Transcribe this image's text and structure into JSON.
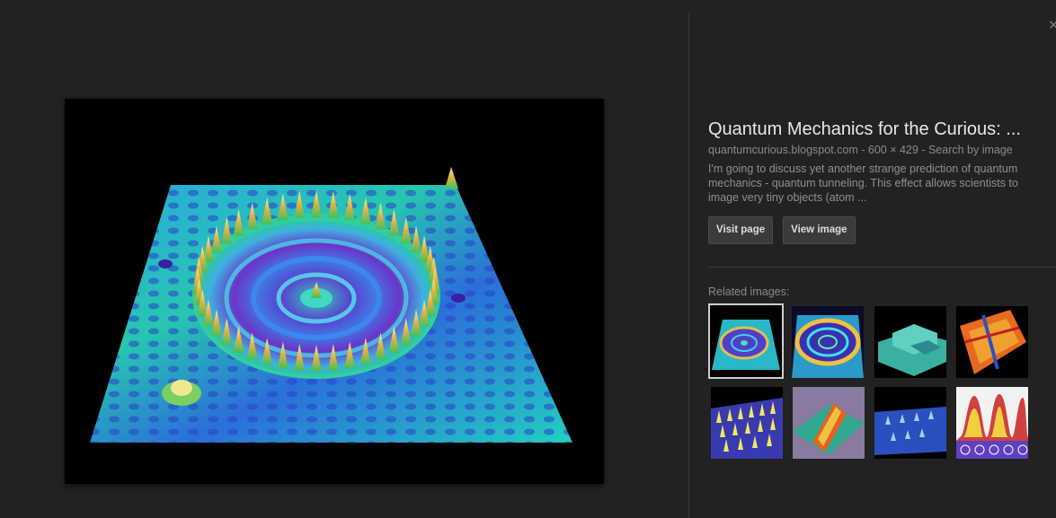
{
  "result": {
    "title": "Quantum Mechanics for the Curious: ...",
    "source": "quantumcurious.blogspot.com",
    "dimensions": "600 × 429",
    "search_by_image": "Search by image",
    "meta_separator": " - ",
    "description": "I'm going to discuss yet another strange prediction of quantum mechanics - quantum tunneling. This effect allows scientists to image very tiny objects (atom ..."
  },
  "buttons": {
    "visit_page": "Visit page",
    "view_image": "View image"
  },
  "related": {
    "label": "Related images:",
    "thumbnails": [
      {
        "name": "quantum-corral-thumb",
        "selected": true
      },
      {
        "name": "quantum-corral-rainbow-thumb",
        "selected": false
      },
      {
        "name": "surface-steps-thumb",
        "selected": false
      },
      {
        "name": "orange-atom-lattice-thumb",
        "selected": false
      },
      {
        "name": "yellow-spikes-thumb",
        "selected": false
      },
      {
        "name": "orange-ridge-thumb",
        "selected": false
      },
      {
        "name": "blue-peaks-thumb",
        "selected": false
      },
      {
        "name": "orbital-peaks-thumb",
        "selected": false
      }
    ]
  },
  "icons": {
    "close": "close-icon"
  },
  "colors": {
    "background": "#222222",
    "button": "#3b3b3b",
    "title": "#e8e8e8",
    "muted": "#8a8a8a"
  }
}
